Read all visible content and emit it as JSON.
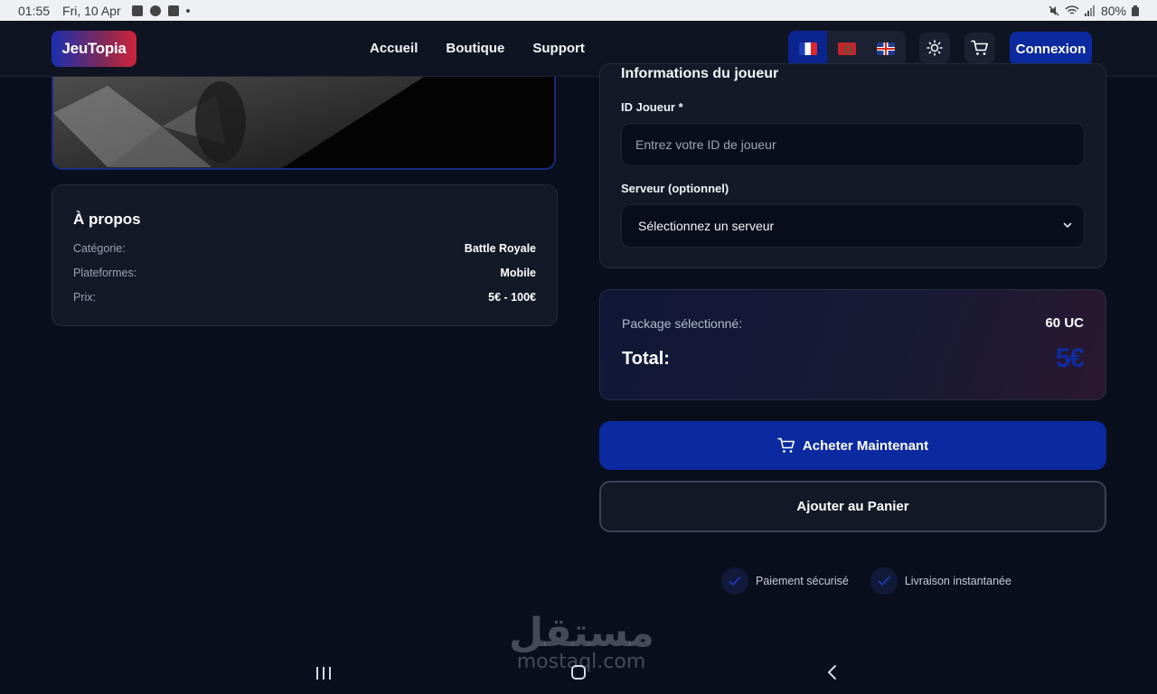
{
  "status_bar": {
    "time": "01:55",
    "date": "Fri, 10 Apr",
    "battery": "80%"
  },
  "header": {
    "logo": "JeuTopia",
    "nav": [
      "Accueil",
      "Boutique",
      "Support"
    ],
    "languages": [
      "fr",
      "ma",
      "uk"
    ],
    "active_language": "fr",
    "login_label": "Connexion"
  },
  "about": {
    "title": "À propos",
    "rows": [
      {
        "label": "Catégorie:",
        "value": "Battle Royale"
      },
      {
        "label": "Plateformes:",
        "value": "Mobile"
      },
      {
        "label": "Prix:",
        "value": "5€ - 100€"
      }
    ]
  },
  "player_info": {
    "section_title": "Informations du joueur",
    "player_id_label": "ID Joueur *",
    "player_id_placeholder": "Entrez votre ID de joueur",
    "player_id_value": "",
    "server_label": "Serveur (optionnel)",
    "server_selected": "Sélectionnez un serveur"
  },
  "summary": {
    "package_label": "Package sélectionné:",
    "package_value": "60 UC",
    "total_label": "Total:",
    "total_value": "5€"
  },
  "actions": {
    "buy_now": "Acheter Maintenant",
    "add_to_cart": "Ajouter au Panier"
  },
  "badges": [
    "Paiement sécurisé",
    "Livraison instantanée"
  ],
  "watermark": {
    "arabic": "مستقل",
    "latin": "mostaql.com"
  },
  "colors": {
    "background": "#0a0f1d",
    "card": "#131927",
    "primary": "#0b2aa0",
    "total_value": "#0f2ca0"
  }
}
